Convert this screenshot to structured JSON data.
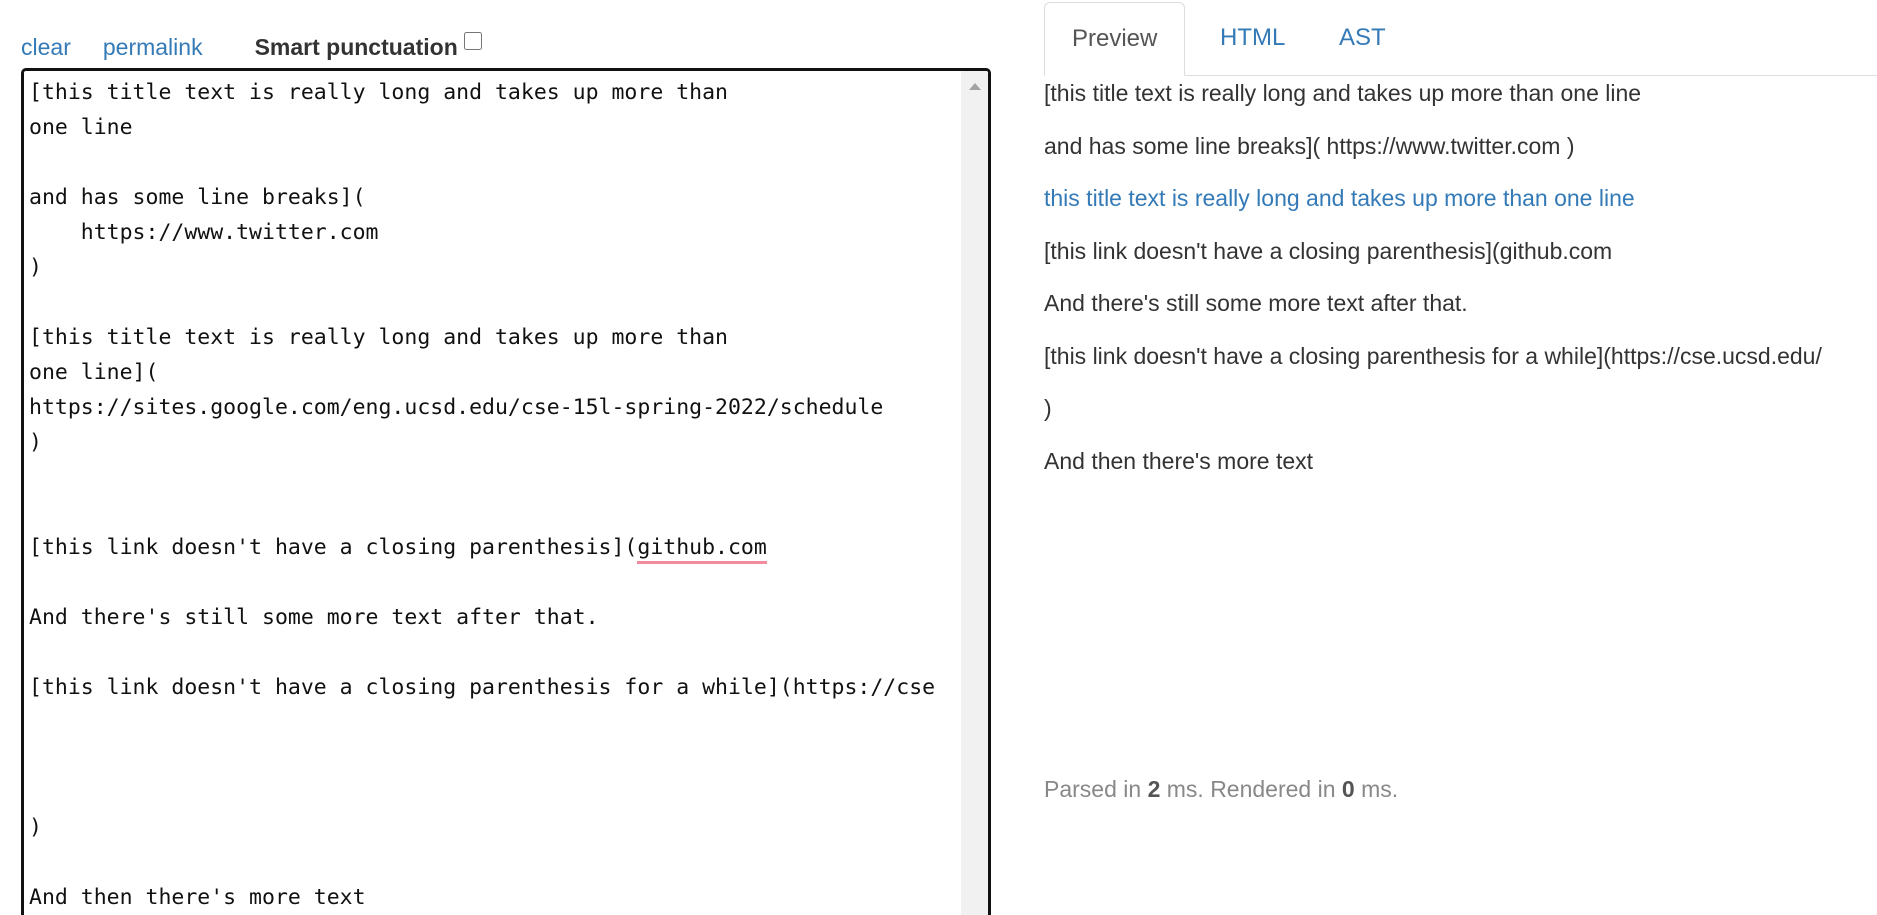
{
  "toolbar": {
    "clear_label": "clear",
    "permalink_label": "permalink",
    "smart_punctuation_label": "Smart punctuation",
    "smart_punctuation_checked": false
  },
  "editor": {
    "lines": [
      "[this title text is really long and takes up more than",
      "one line",
      "",
      "and has some line breaks](",
      "    https://www.twitter.com",
      ")",
      "",
      "[this title text is really long and takes up more than",
      "one line](",
      "https://sites.google.com/eng.ucsd.edu/cse-15l-spring-2022/schedule",
      ")",
      "",
      "",
      "[this link doesn't have a closing parenthesis](",
      "",
      "And there's still some more text after that.",
      "",
      "[this link doesn't have a closing parenthesis for a while](https://cse",
      "",
      "",
      "",
      ")",
      "",
      "And then there's more text"
    ],
    "misspelled_word": "github.com"
  },
  "tabs": [
    {
      "label": "Preview",
      "active": true
    },
    {
      "label": "HTML",
      "active": false
    },
    {
      "label": "AST",
      "active": false
    }
  ],
  "preview": {
    "p1": "[this title text is really long and takes up more than one line",
    "p2": "and has some line breaks]( https://www.twitter.com )",
    "p3_link": "this title text is really long and takes up more than one line",
    "p4": "[this link doesn't have a closing parenthesis](github.com",
    "p5": "And there's still some more text after that.",
    "p6": "[this link doesn't have a closing parenthesis for a while](https://cse.ucsd.edu/",
    "p7": ")",
    "p8": "And then there's more text"
  },
  "timing": {
    "parsed_prefix": "Parsed in ",
    "parsed_ms": "2",
    "rendered_prefix": " ms. Rendered in ",
    "rendered_ms": "0",
    "suffix": " ms."
  },
  "colors": {
    "link": "#337ab7",
    "spellcheck_underline": "#f38ba0",
    "muted_text": "#888888"
  }
}
